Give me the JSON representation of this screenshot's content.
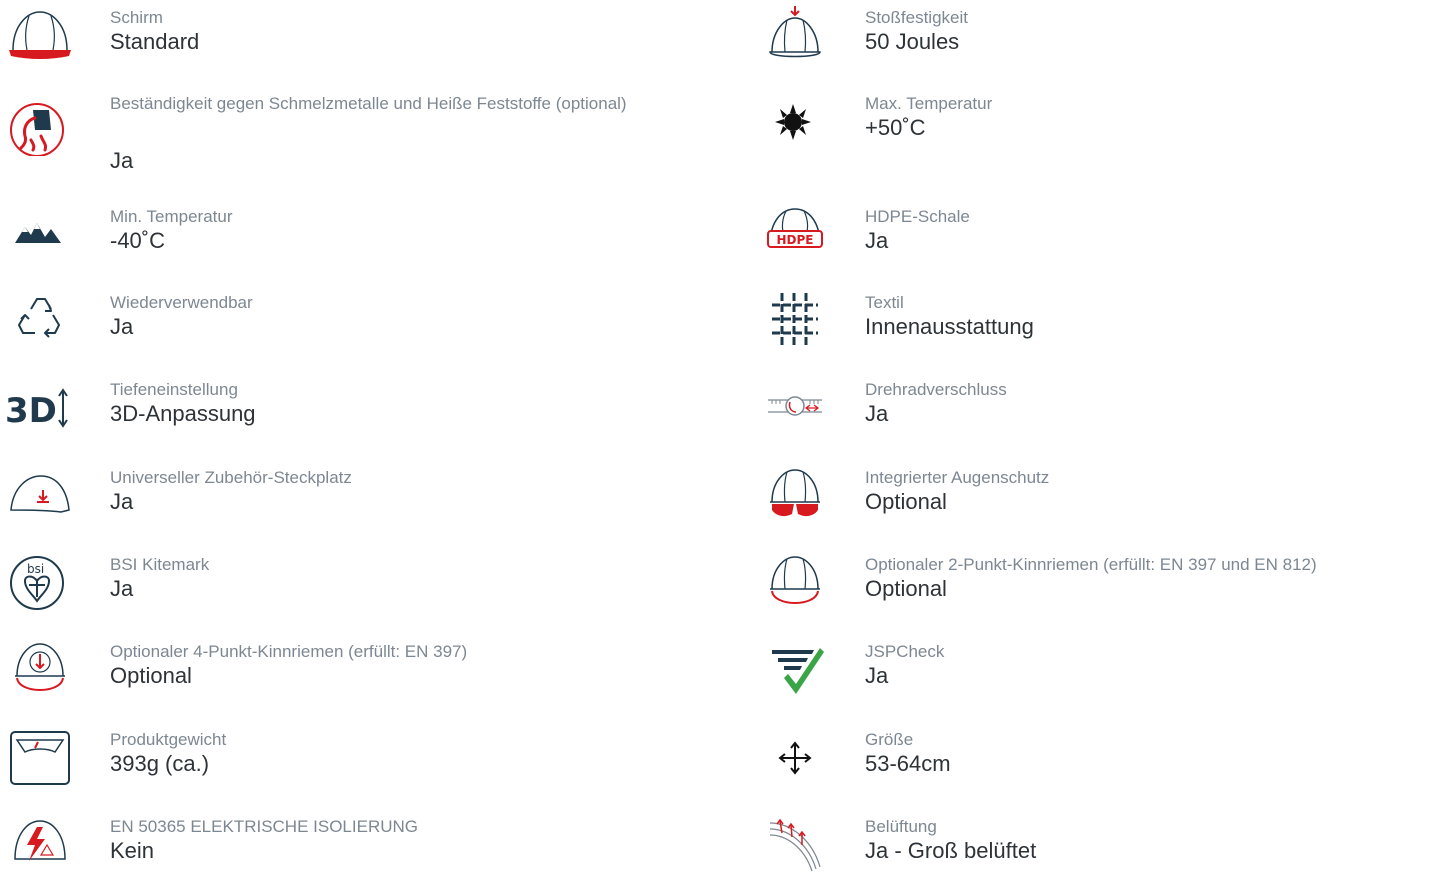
{
  "colors": {
    "label": "#7d8792",
    "value": "#2e3338",
    "accent": "#d71920",
    "icon": "#1f3a4d",
    "check": "#3aa546"
  },
  "left": [
    {
      "icon": "helmet-brim-icon",
      "label": "Schirm",
      "value": "Standard"
    },
    {
      "icon": "molten-metal-icon",
      "label": "Beständigkeit gegen Schmelzmetalle und Heiße Feststoffe (optional)",
      "value": "Ja"
    },
    {
      "icon": "mountain-cold-icon",
      "label": "Min. Temperatur",
      "value": "-40˚C"
    },
    {
      "icon": "recycle-icon",
      "label": "Wiederverwendbar",
      "value": "Ja"
    },
    {
      "icon": "3d-depth-icon",
      "label": "Tiefeneinstellung",
      "value": "3D-Anpassung"
    },
    {
      "icon": "accessory-slot-icon",
      "label": "Universeller Zubehör-Steckplatz",
      "value": "Ja"
    },
    {
      "icon": "bsi-kitemark-icon",
      "label": "BSI Kitemark",
      "value": "Ja"
    },
    {
      "icon": "chinstrap-4pt-icon",
      "label": "Optionaler 4-Punkt-Kinnriemen (erfüllt: EN 397)",
      "value": "Optional"
    },
    {
      "icon": "weight-scale-icon",
      "label": "Produktgewicht",
      "value": "393g (ca.)"
    },
    {
      "icon": "electrical-insulation-icon",
      "label": "EN 50365 ELEKTRISCHE ISOLIERUNG",
      "value": "Kein"
    }
  ],
  "right": [
    {
      "icon": "impact-icon",
      "label": "Stoßfestigkeit",
      "value": "50 Joules"
    },
    {
      "icon": "sun-heat-icon",
      "label": "Max. Temperatur",
      "value": "+50˚C"
    },
    {
      "icon": "hdpe-shell-icon",
      "label": "HDPE-Schale",
      "value": "Ja",
      "badge": "HDPE"
    },
    {
      "icon": "textile-icon",
      "label": "Textil",
      "value": "Innenausstattung"
    },
    {
      "icon": "wheel-ratchet-icon",
      "label": "Drehradverschluss",
      "value": "Ja"
    },
    {
      "icon": "eye-protection-icon",
      "label": "Integrierter Augenschutz",
      "value": "Optional"
    },
    {
      "icon": "chinstrap-2pt-icon",
      "label": "Optionaler 2-Punkt-Kinnriemen (erfüllt: EN 397 und EN 812)",
      "value": "Optional"
    },
    {
      "icon": "jspcheck-icon",
      "label": "JSPCheck",
      "value": "Ja"
    },
    {
      "icon": "size-arrows-icon",
      "label": "Größe",
      "value": "53-64cm"
    },
    {
      "icon": "ventilation-icon",
      "label": "Belüftung",
      "value": "Ja - Groß belüftet"
    }
  ]
}
